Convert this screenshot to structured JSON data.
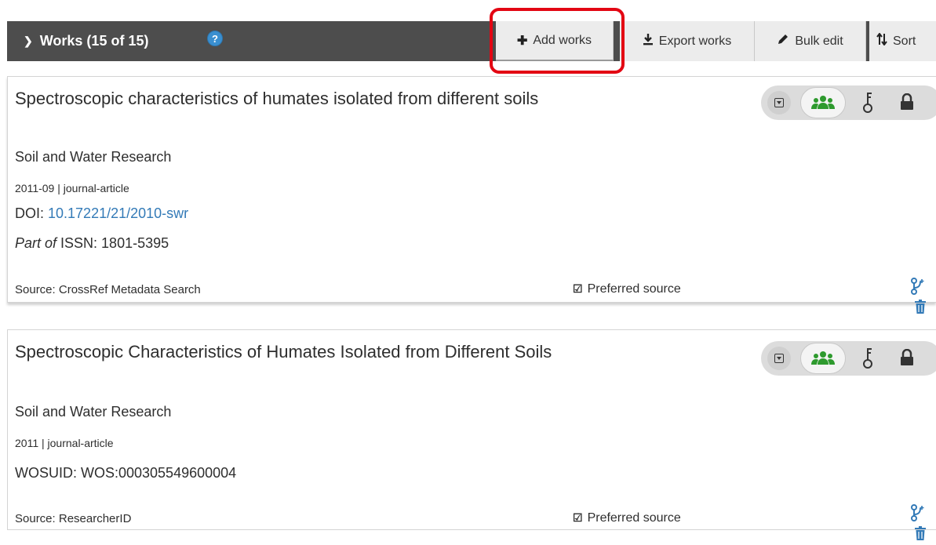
{
  "header": {
    "title": "Works (15 of 15)",
    "help": "?",
    "buttons": {
      "add": "Add works",
      "export": "Export works",
      "bulk": "Bulk edit",
      "sort": "Sort"
    }
  },
  "icons": {
    "toggle": "chevron-down-icon",
    "add": "plus-icon",
    "export": "download-icon",
    "bulk": "pencil-icon",
    "sort": "sort-arrows-icon",
    "preferred": "check-square-icon",
    "combine": "fork-icon",
    "delete": "trash-icon"
  },
  "colors": {
    "header_bg": "#4d4d4d",
    "link": "#337ab7",
    "everyone_green": "#2e9a2e",
    "highlight": "#e30613"
  },
  "works": [
    {
      "title": "Spectroscopic characteristics of humates isolated from different soils",
      "journal": "Soil and Water Research",
      "meta": "2011-09 | journal-article",
      "id_label": "DOI: ",
      "id_value": "10.17221/21/2010-swr",
      "extra_prefix": "Part of",
      "extra_value": " ISSN: 1801-5395",
      "source": "Source: CrossRef Metadata Search",
      "preferred": "Preferred source"
    },
    {
      "title": "Spectroscopic Characteristics of Humates Isolated from Different Soils",
      "journal": "Soil and Water Research",
      "meta": "2011 | journal-article",
      "id_label": "WOSUID: ",
      "id_value": "WOS:000305549600004",
      "source": "Source: ResearcherID",
      "preferred": "Preferred source"
    }
  ]
}
